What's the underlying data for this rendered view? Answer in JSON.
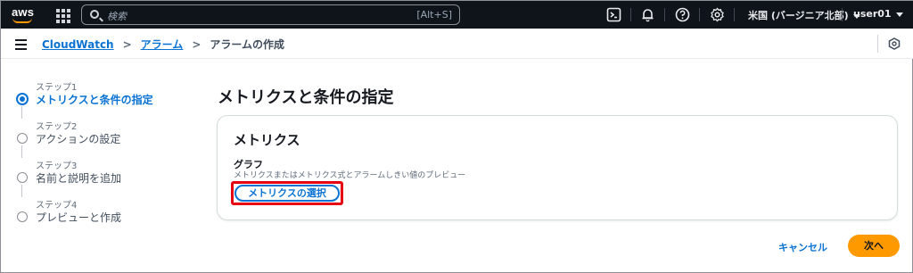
{
  "topnav": {
    "logo_text": "aws",
    "search_placeholder": "検索",
    "search_shortcut": "[Alt+S]",
    "region_label": "米国 (バージニア北部)",
    "user_label": "user01",
    "icons": [
      "apps-grid-icon",
      "cloudshell-icon",
      "bell-icon",
      "help-icon",
      "gear-icon"
    ]
  },
  "breadcrumb": {
    "items": [
      {
        "label": "CloudWatch"
      },
      {
        "label": "アラーム"
      },
      {
        "label": "アラームの作成"
      }
    ]
  },
  "steps": [
    {
      "number": "ステップ1",
      "name": "メトリクスと条件の指定",
      "state": "active"
    },
    {
      "number": "ステップ2",
      "name": "アクションの設定",
      "state": "inactive"
    },
    {
      "number": "ステップ3",
      "name": "名前と説明を追加",
      "state": "inactive"
    },
    {
      "number": "ステップ4",
      "name": "プレビューと作成",
      "state": "inactive"
    }
  ],
  "main": {
    "title": "メトリクスと条件の指定",
    "panel": {
      "title": "メトリクス",
      "field_label": "グラフ",
      "field_description": "メトリクスまたはメトリクス式とアラームしきい値のプレビュー",
      "select_button_label": "メトリクスの選択"
    }
  },
  "footer": {
    "cancel_label": "キャンセル",
    "next_label": "次へ"
  },
  "colors": {
    "accent": "#0972d3",
    "primary_button": "#ff9900",
    "highlight_frame": "#e60012",
    "topnav_bg": "#0f141a"
  }
}
